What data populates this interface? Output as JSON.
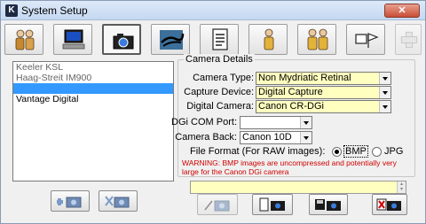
{
  "window": {
    "title": "System Setup",
    "app_icon_letter": "K",
    "close_glyph": "✕"
  },
  "toolbar": {
    "buttons": [
      {
        "icon": "users-icon"
      },
      {
        "icon": "computer-icon"
      },
      {
        "icon": "camera-icon",
        "active": true
      },
      {
        "icon": "retina-image-icon"
      },
      {
        "icon": "document-icon"
      },
      {
        "icon": "person-icon"
      },
      {
        "icon": "two-persons-icon"
      },
      {
        "icon": "flag-icon"
      },
      {
        "icon": "plus-icon",
        "disabled": true
      }
    ]
  },
  "camera_list": {
    "items": [
      "Keeler KSL",
      "Haag-Streit IM900",
      "",
      "Vantage Digital"
    ],
    "selected_index": 2
  },
  "camera_details": {
    "legend": "Camera Details",
    "camera_type": {
      "label": "Camera Type:",
      "value": "Non Mydriatic Retinal"
    },
    "capture_device": {
      "label": "Capture Device:",
      "value": "Digital Capture"
    },
    "digital_camera": {
      "label": "Digital Camera:",
      "value": "Canon CR-DGi"
    },
    "dgi_com_port": {
      "label": "DGi COM Port:",
      "value": ""
    },
    "camera_back": {
      "label": "Camera Back:",
      "value": "Canon 10D"
    },
    "file_format": {
      "label": "File Format (For RAW images):",
      "options": [
        "BMP",
        "JPG"
      ],
      "selected": "BMP"
    },
    "warning": "WARNING: BMP images are uncompressed and potentially very large for the Canon DGi camera"
  },
  "status_box": {
    "value": ""
  },
  "colors": {
    "selection": "#3399ff",
    "field_yellow": "#ffffc0",
    "warning_red": "#d00000",
    "close_red": "#c94d36"
  }
}
